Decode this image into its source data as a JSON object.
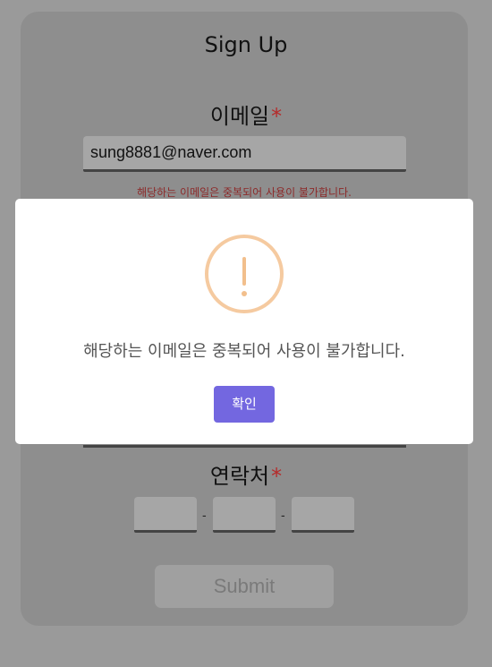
{
  "form": {
    "title": "Sign Up",
    "email_label": "이메일",
    "required_mark": "*",
    "email_value": "sung8881@naver.com",
    "email_error": "해당하는 이메일은 중복되어 사용이 불가합니다.",
    "phone_label": "연락처",
    "phone_separator": "-",
    "submit_label": "Submit"
  },
  "modal": {
    "icon": "warning-exclamation-icon",
    "message": "해당하는 이메일은 중복되어 사용이 불가합니다.",
    "confirm_label": "확인"
  },
  "colors": {
    "overlay": "#9a9a9a",
    "confirm_button": "#7367e0",
    "warning_icon": "#f2bf8c",
    "error_text": "#8c2a2a",
    "required_mark": "#b52b2b"
  }
}
